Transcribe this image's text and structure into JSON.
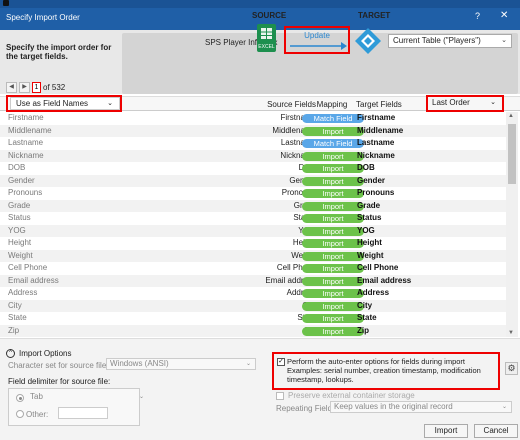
{
  "window": {
    "title": "Specify Import Order",
    "help": "?",
    "close": "✕"
  },
  "header": {
    "prompt": "Specify the import order for the target fields.",
    "record_current": "1",
    "record_of": "of 532",
    "source_heading": "SOURCE",
    "target_heading": "TARGET",
    "source_file": "SPS Player Info.xlsx",
    "excel_badge": "EXCEL",
    "update_button": "Update",
    "target_table": "Current Table (\"Players\")"
  },
  "columns": {
    "field_names_option": "Use as Field Names",
    "source_fields": "Source Fields",
    "mapping": "Mapping",
    "target_fields": "Target Fields",
    "order_option": "Last Order"
  },
  "rows": [
    {
      "first": "Firstname",
      "source": "Firstname",
      "mapping": "Match Field",
      "target": "Firstname"
    },
    {
      "first": "Middlename",
      "source": "Middlename",
      "mapping": "Import",
      "target": "Middlename"
    },
    {
      "first": "Lastname",
      "source": "Lastname",
      "mapping": "Match Field",
      "target": "Lastname"
    },
    {
      "first": "Nickname",
      "source": "Nickname",
      "mapping": "Import",
      "target": "Nickname"
    },
    {
      "first": "DOB",
      "source": "DOB",
      "mapping": "Import",
      "target": "DOB"
    },
    {
      "first": "Gender",
      "source": "Gender",
      "mapping": "Import",
      "target": "Gender"
    },
    {
      "first": "Pronouns",
      "source": "Pronouns",
      "mapping": "Import",
      "target": "Pronouns"
    },
    {
      "first": "Grade",
      "source": "Grade",
      "mapping": "Import",
      "target": "Grade"
    },
    {
      "first": "Status",
      "source": "Status",
      "mapping": "Import",
      "target": "Status"
    },
    {
      "first": "YOG",
      "source": "YOG",
      "mapping": "Import",
      "target": "YOG"
    },
    {
      "first": "Height",
      "source": "Height",
      "mapping": "Import",
      "target": "Height"
    },
    {
      "first": "Weight",
      "source": "Weight",
      "mapping": "Import",
      "target": "Weight"
    },
    {
      "first": "Cell Phone",
      "source": "Cell Phone",
      "mapping": "Import",
      "target": "Cell Phone"
    },
    {
      "first": "Email address",
      "source": "Email address",
      "mapping": "Import",
      "target": "Email address"
    },
    {
      "first": "Address",
      "source": "Address",
      "mapping": "Import",
      "target": "Address"
    },
    {
      "first": "City",
      "source": "City",
      "mapping": "Import",
      "target": "City"
    },
    {
      "first": "State",
      "source": "State",
      "mapping": "Import",
      "target": "State"
    },
    {
      "first": "Zip",
      "source": "Zip",
      "mapping": "Import",
      "target": "Zip"
    }
  ],
  "options": {
    "heading": "Import Options",
    "charset_label": "Character set for source file:",
    "charset_value": "Windows (ANSI)",
    "delimiter_label": "Field delimiter for source file:",
    "tab_option": "Tab",
    "other_option": "Other:",
    "auto_enter_text": "Perform the auto-enter options for fields during import",
    "auto_enter_examples": "Examples: serial number, creation timestamp, modification timestamp, lookups.",
    "preserve_label": "Preserve external container storage",
    "repeating_label": "Repeating Fields:",
    "repeating_value": "Keep values in the original record"
  },
  "buttons": {
    "import": "Import",
    "cancel": "Cancel"
  },
  "colors": {
    "titlebar": "#1f5fa7",
    "import_pill": "#6cc24a",
    "match_pill": "#5aa7e8",
    "highlight": "#e00000"
  }
}
